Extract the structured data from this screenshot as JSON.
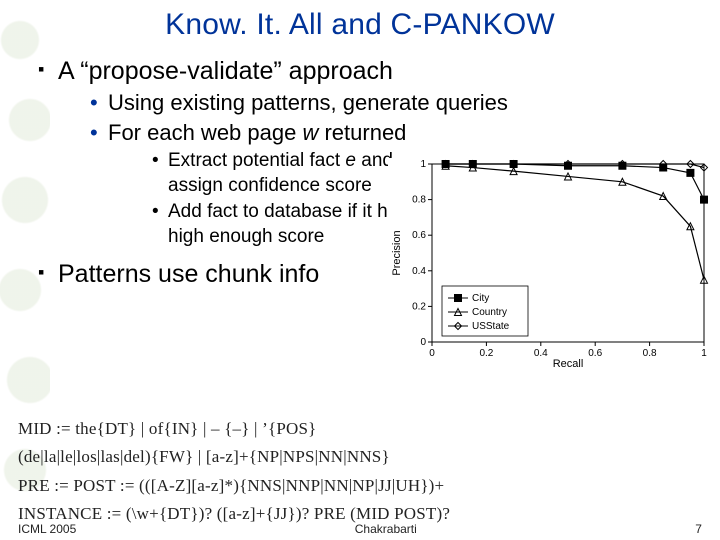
{
  "title": "Know. It. All and C-PANKOW",
  "bullets": {
    "l1a": "A “propose-validate” approach",
    "l2a": "Using existing patterns, generate queries",
    "l2b_pre": "For each web page ",
    "l2b_var": "w",
    "l2b_post": "  returned",
    "l3a_pre": "Extract potential fact ",
    "l3a_var": "e",
    "l3a_post": " and assign confidence score",
    "l3b": "Add fact to database if it has high enough score",
    "l1b": "Patterns use chunk info"
  },
  "chart_data": {
    "type": "line",
    "xlabel": "Recall",
    "ylabel": "Precision",
    "xlim": [
      0,
      1
    ],
    "ylim": [
      0,
      1
    ],
    "xticks": [
      0,
      0.2,
      0.4,
      0.6,
      0.8,
      1
    ],
    "yticks": [
      0,
      0.2,
      0.4,
      0.6,
      0.8,
      1
    ],
    "legend_position": "inside-lower-left",
    "series": [
      {
        "name": "City",
        "marker": "square",
        "x": [
          0.05,
          0.15,
          0.3,
          0.5,
          0.7,
          0.85,
          0.95,
          1.0
        ],
        "y": [
          1.0,
          1.0,
          1.0,
          0.99,
          0.99,
          0.98,
          0.95,
          0.8
        ]
      },
      {
        "name": "Country",
        "marker": "triangle",
        "x": [
          0.05,
          0.15,
          0.3,
          0.5,
          0.7,
          0.85,
          0.95,
          1.0
        ],
        "y": [
          0.99,
          0.98,
          0.96,
          0.93,
          0.9,
          0.82,
          0.65,
          0.35
        ]
      },
      {
        "name": "USState",
        "marker": "diamond",
        "x": [
          0.05,
          0.15,
          0.3,
          0.5,
          0.7,
          0.85,
          0.95,
          1.0
        ],
        "y": [
          1.0,
          1.0,
          1.0,
          1.0,
          1.0,
          1.0,
          1.0,
          0.98
        ]
      }
    ]
  },
  "formulas": {
    "f1": "MID := the{DT} | of{IN} | – {–} | ’{POS}",
    "f2": "(de|la|le|los|las|del){FW} | [a-z]+{NP|NPS|NN|NNS}",
    "f3": "PRE := POST := (([A-Z][a-z]*){NNS|NNP|NN|NP|JJ|UH})+",
    "f4": "INSTANCE := (\\w+{DT})? ([a-z]+{JJ})? PRE (MID POST)?"
  },
  "footer": {
    "left": "ICML 2005",
    "center": "Chakrabarti",
    "right": "7"
  }
}
